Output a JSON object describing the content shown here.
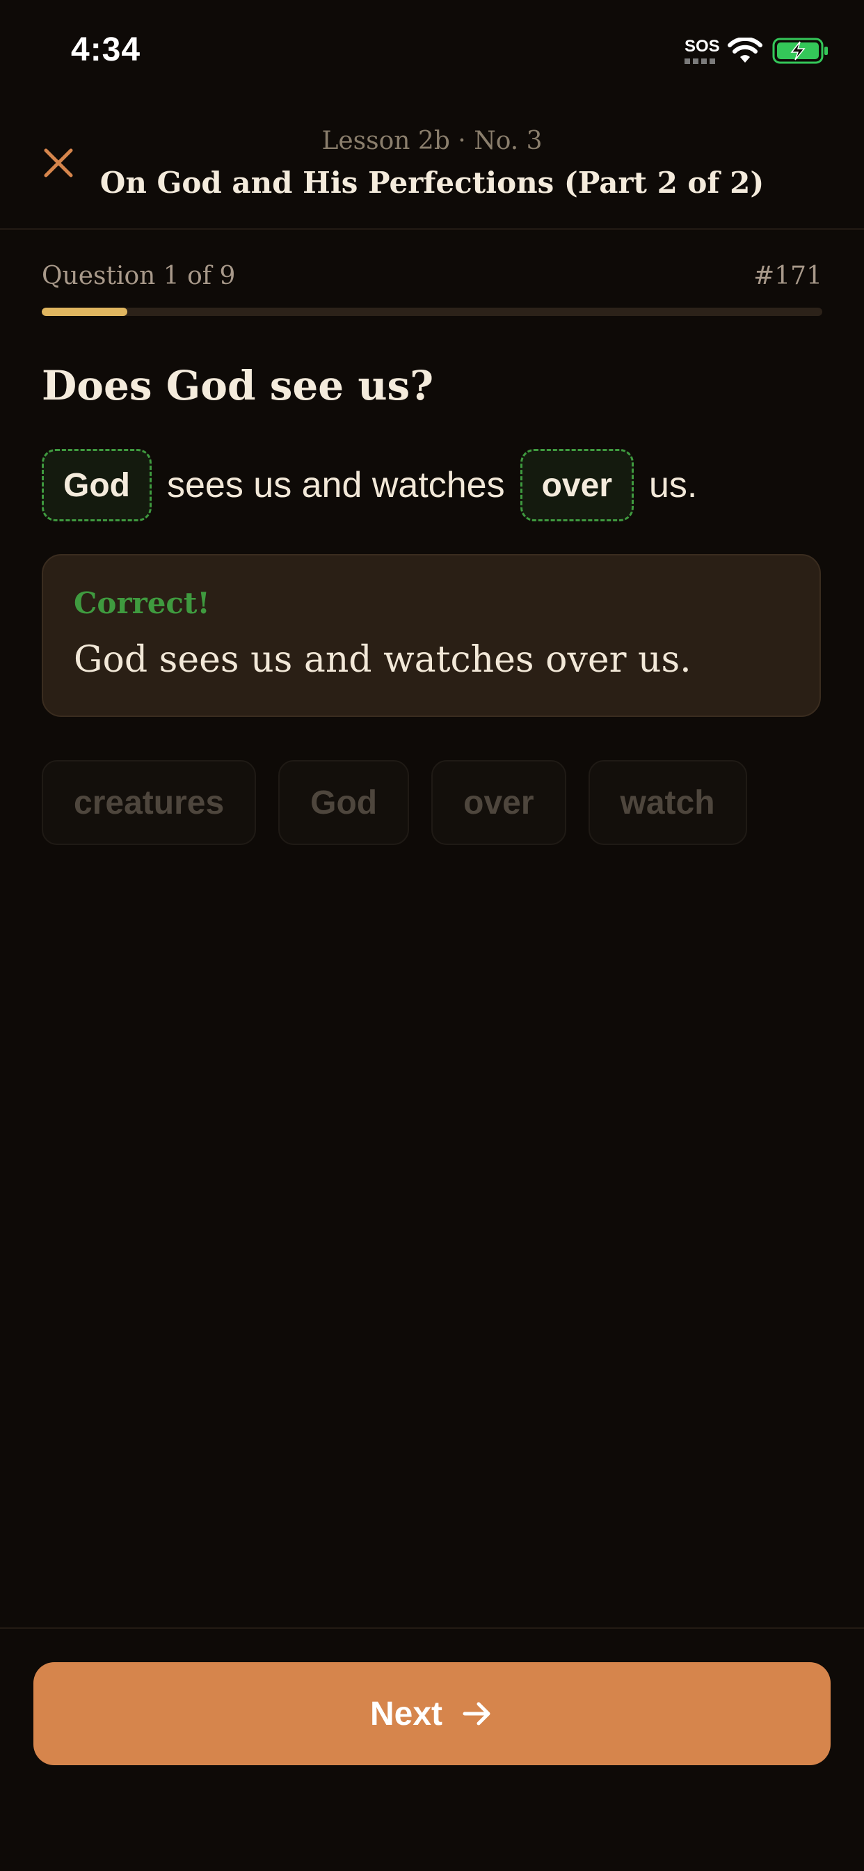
{
  "status_bar": {
    "time": "4:34",
    "sos": "SOS"
  },
  "header": {
    "close_icon": "close-icon",
    "subtitle": "Lesson 2b · No. 3",
    "title": "On God and His Perfections (Part 2 of 2)"
  },
  "progress": {
    "counter": "Question 1 of 9",
    "number": "#171",
    "current": 1,
    "total": 9,
    "fill_fraction": 0.11
  },
  "question": {
    "text": "Does God see us?",
    "sentence": {
      "blank1": "God",
      "text1": "sees us and watches",
      "blank2": "over",
      "text2": "us."
    }
  },
  "feedback": {
    "label": "Correct!",
    "text": "God sees us and watches over us."
  },
  "word_bank": [
    "creatures",
    "God",
    "over",
    "watch"
  ],
  "actions": {
    "next_label": "Next",
    "next_icon": "arrow-right-icon"
  },
  "colors": {
    "background": "#0e0a07",
    "accent": "#d6854c",
    "correct": "#3f9a3f",
    "progress": "#e0b660"
  }
}
